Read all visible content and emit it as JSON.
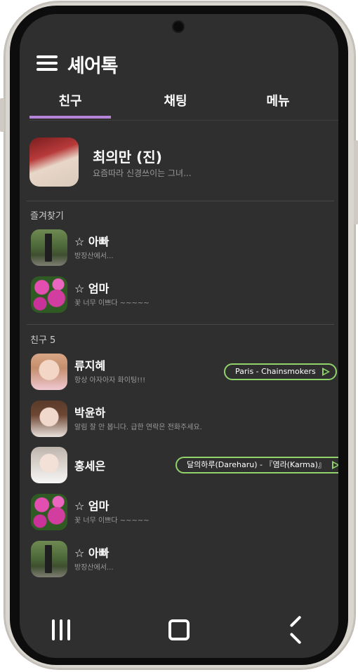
{
  "app": {
    "title": "셰어톡"
  },
  "tabs": [
    {
      "label": "친구",
      "active": true
    },
    {
      "label": "채팅",
      "active": false
    },
    {
      "label": "메뉴",
      "active": false
    }
  ],
  "my_profile": {
    "name": "최의만 (진)",
    "status": "요즘따라 신경쓰이는 그녀..."
  },
  "favorites": {
    "label": "즐겨찾기",
    "items": [
      {
        "name": "☆ 아빠",
        "status": "방장산에서..."
      },
      {
        "name": "☆ 엄마",
        "status": "꽃 너무 이쁘다 ~~~~~"
      }
    ]
  },
  "friends": {
    "label": "친구 5",
    "items": [
      {
        "name": "류지혜",
        "status": "항상 아자아자 화이팅!!!",
        "music": "Paris - Chainsmokers"
      },
      {
        "name": "박윤하",
        "status": "알림 잘 안 봅니다. 급한 연락은 전화주세요.",
        "music": ""
      },
      {
        "name": "홍세은",
        "status": "",
        "music": "달의하루(Dareharu) - 『염라(Karma)』"
      },
      {
        "name": "☆ 엄마",
        "status": "꽃 너무 이쁘다 ~~~~~",
        "music": ""
      },
      {
        "name": "☆ 아빠",
        "status": "방장산에서...",
        "music": ""
      }
    ]
  },
  "colors": {
    "background": "#2f2f2f",
    "tab_indicator": "#b783d8",
    "music_accent": "#8fd36a"
  }
}
